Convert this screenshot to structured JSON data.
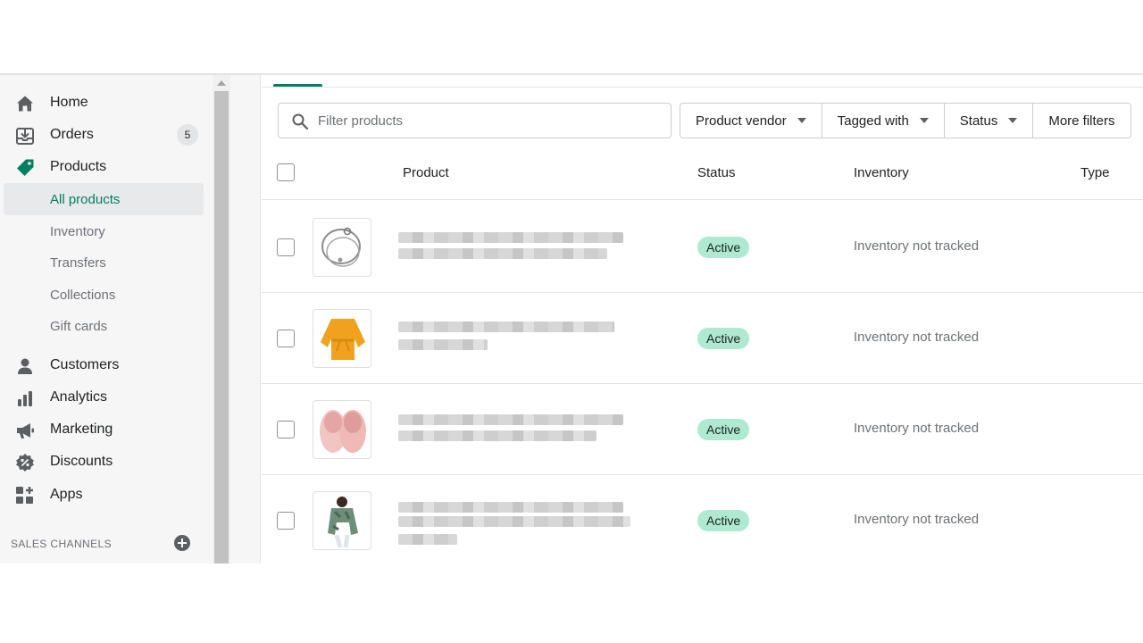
{
  "nav": {
    "items": [
      {
        "label": "Home",
        "icon": "home-icon"
      },
      {
        "label": "Orders",
        "icon": "orders-icon",
        "badge": "5"
      },
      {
        "label": "Products",
        "icon": "tag-icon"
      },
      {
        "label": "All products"
      },
      {
        "label": "Inventory"
      },
      {
        "label": "Transfers"
      },
      {
        "label": "Collections"
      },
      {
        "label": "Gift cards"
      },
      {
        "label": "Customers",
        "icon": "person-icon"
      },
      {
        "label": "Analytics",
        "icon": "bar-chart-icon"
      },
      {
        "label": "Marketing",
        "icon": "megaphone-icon"
      },
      {
        "label": "Discounts",
        "icon": "discount-icon"
      },
      {
        "label": "Apps",
        "icon": "apps-icon"
      }
    ],
    "sales_channels": "SALES CHANNELS"
  },
  "search": {
    "placeholder": "Filter products"
  },
  "filters": [
    "Product vendor",
    "Tagged with",
    "Status",
    "More filters"
  ],
  "table": {
    "headers": [
      "Product",
      "Status",
      "Inventory",
      "Type"
    ],
    "rows": [
      {
        "thumbnail": "bracelet",
        "status": "Active",
        "inventory": "Inventory not tracked"
      },
      {
        "thumbnail": "orange-top",
        "status": "Active",
        "inventory": "Inventory not tracked"
      },
      {
        "thumbnail": "pink-slippers",
        "status": "Active",
        "inventory": "Inventory not tracked"
      },
      {
        "thumbnail": "camo-jacket",
        "status": "Active",
        "inventory": "Inventory not tracked"
      }
    ]
  },
  "colors": {
    "accent": "#008060",
    "selected_text": "#007f5f",
    "status_active_bg": "#aee9d1"
  }
}
